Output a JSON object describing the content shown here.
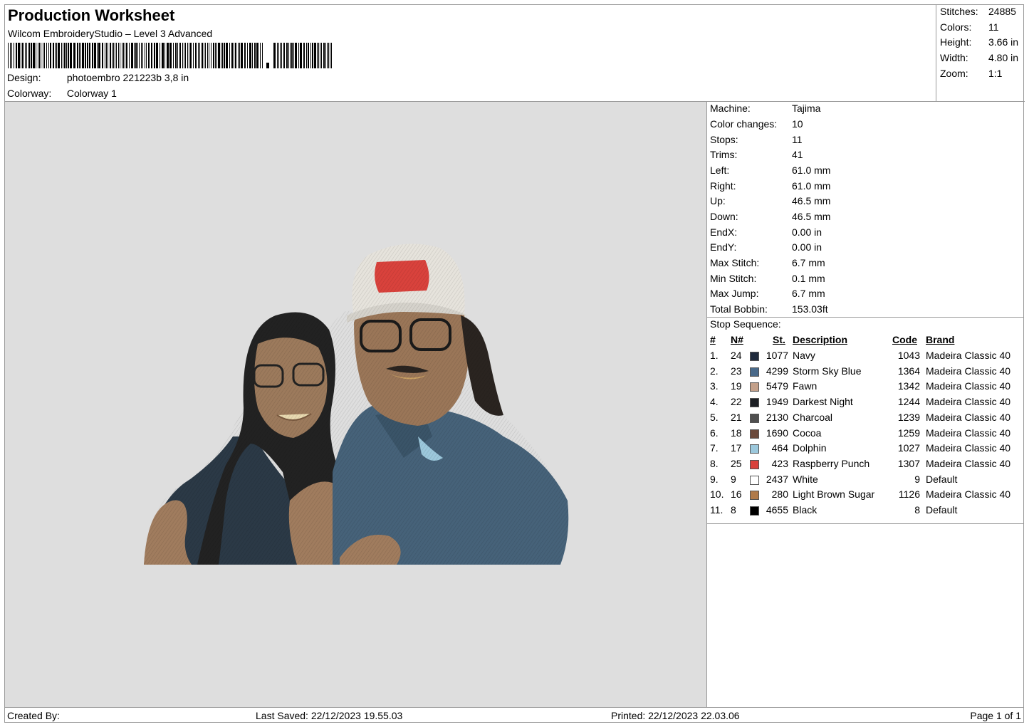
{
  "header": {
    "title": "Production Worksheet",
    "subtitle": "Wilcom EmbroideryStudio – Level 3 Advanced",
    "design_label": "Design:",
    "design_value": "photoembro 221223b 3,8 in",
    "colorway_label": "Colorway:",
    "colorway_value": "Colorway 1"
  },
  "summary": [
    {
      "label": "Stitches:",
      "value": "24885"
    },
    {
      "label": "Colors:",
      "value": "11"
    },
    {
      "label": "Height:",
      "value": "3.66 in"
    },
    {
      "label": "Width:",
      "value": "4.80 in"
    },
    {
      "label": "Zoom:",
      "value": "1:1"
    }
  ],
  "machine": [
    {
      "label": "Machine:",
      "value": "Tajima"
    },
    {
      "label": "Color changes:",
      "value": "10"
    },
    {
      "label": "Stops:",
      "value": "11"
    },
    {
      "label": "Trims:",
      "value": "41"
    },
    {
      "label": "Left:",
      "value": "61.0 mm"
    },
    {
      "label": "Right:",
      "value": "61.0 mm"
    },
    {
      "label": "Up:",
      "value": "46.5 mm"
    },
    {
      "label": "Down:",
      "value": "46.5 mm"
    },
    {
      "label": "EndX:",
      "value": "0.00 in"
    },
    {
      "label": "EndY:",
      "value": "0.00 in"
    },
    {
      "label": "Max Stitch:",
      "value": "6.7 mm"
    },
    {
      "label": "Min Stitch:",
      "value": "0.1 mm"
    },
    {
      "label": "Max Jump:",
      "value": "6.7 mm"
    },
    {
      "label": "Total Bobbin:",
      "value": "153.03ft"
    }
  ],
  "stop_sequence": {
    "title": "Stop Sequence:",
    "headers": {
      "num": "#",
      "needle": "N#",
      "stitches": "St.",
      "description": "Description",
      "code": "Code",
      "brand": "Brand"
    },
    "rows": [
      {
        "num": "1.",
        "needle": "24",
        "stitches": "1077",
        "color": "#1f2a3c",
        "description": "Navy",
        "code": "1043",
        "brand": "Madeira Classic 40"
      },
      {
        "num": "2.",
        "needle": "23",
        "stitches": "4299",
        "color": "#4a6a8a",
        "description": "Storm Sky Blue",
        "code": "1364",
        "brand": "Madeira Classic 40"
      },
      {
        "num": "3.",
        "needle": "19",
        "stitches": "5479",
        "color": "#c3a08a",
        "description": "Fawn",
        "code": "1342",
        "brand": "Madeira Classic 40"
      },
      {
        "num": "4.",
        "needle": "22",
        "stitches": "1949",
        "color": "#1c1f24",
        "description": "Darkest Night",
        "code": "1244",
        "brand": "Madeira Classic 40"
      },
      {
        "num": "5.",
        "needle": "21",
        "stitches": "2130",
        "color": "#4f4f4f",
        "description": "Charcoal",
        "code": "1239",
        "brand": "Madeira Classic 40"
      },
      {
        "num": "6.",
        "needle": "18",
        "stitches": "1690",
        "color": "#6b4a3c",
        "description": "Cocoa",
        "code": "1259",
        "brand": "Madeira Classic 40"
      },
      {
        "num": "7.",
        "needle": "17",
        "stitches": "464",
        "color": "#9cc8dc",
        "description": "Dolphin",
        "code": "1027",
        "brand": "Madeira Classic 40"
      },
      {
        "num": "8.",
        "needle": "25",
        "stitches": "423",
        "color": "#d9423c",
        "description": "Raspberry Punch",
        "code": "1307",
        "brand": "Madeira Classic 40"
      },
      {
        "num": "9.",
        "needle": "9",
        "stitches": "2437",
        "color": "#ffffff",
        "description": "White",
        "code": "9",
        "brand": "Default"
      },
      {
        "num": "10.",
        "needle": "16",
        "stitches": "280",
        "color": "#b07a4a",
        "description": "Light Brown Sugar",
        "code": "1126",
        "brand": "Madeira Classic 40"
      },
      {
        "num": "11.",
        "needle": "8",
        "stitches": "4655",
        "color": "#000000",
        "description": "Black",
        "code": "8",
        "brand": "Default"
      }
    ]
  },
  "footer": {
    "created_by": "Created By:",
    "last_saved": "Last Saved: 22/12/2023 19.55.03",
    "printed": "Printed: 22/12/2023 22.03.06",
    "page": "Page 1 of 1"
  }
}
